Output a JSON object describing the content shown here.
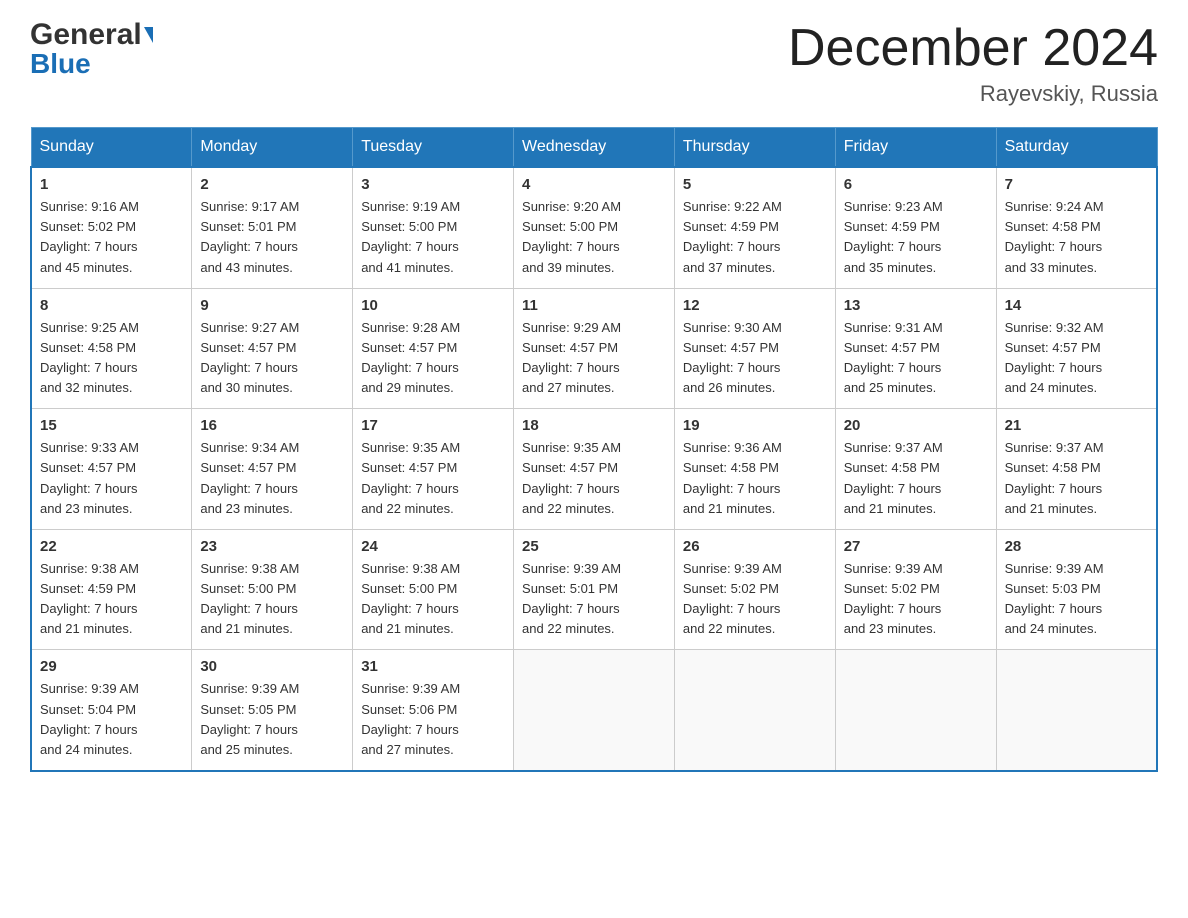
{
  "header": {
    "logo_general": "General",
    "logo_blue": "Blue",
    "month_title": "December 2024",
    "location": "Rayevskiy, Russia"
  },
  "weekdays": [
    "Sunday",
    "Monday",
    "Tuesday",
    "Wednesday",
    "Thursday",
    "Friday",
    "Saturday"
  ],
  "weeks": [
    [
      {
        "day": "1",
        "sunrise": "9:16 AM",
        "sunset": "5:02 PM",
        "daylight": "7 hours and 45 minutes."
      },
      {
        "day": "2",
        "sunrise": "9:17 AM",
        "sunset": "5:01 PM",
        "daylight": "7 hours and 43 minutes."
      },
      {
        "day": "3",
        "sunrise": "9:19 AM",
        "sunset": "5:00 PM",
        "daylight": "7 hours and 41 minutes."
      },
      {
        "day": "4",
        "sunrise": "9:20 AM",
        "sunset": "5:00 PM",
        "daylight": "7 hours and 39 minutes."
      },
      {
        "day": "5",
        "sunrise": "9:22 AM",
        "sunset": "4:59 PM",
        "daylight": "7 hours and 37 minutes."
      },
      {
        "day": "6",
        "sunrise": "9:23 AM",
        "sunset": "4:59 PM",
        "daylight": "7 hours and 35 minutes."
      },
      {
        "day": "7",
        "sunrise": "9:24 AM",
        "sunset": "4:58 PM",
        "daylight": "7 hours and 33 minutes."
      }
    ],
    [
      {
        "day": "8",
        "sunrise": "9:25 AM",
        "sunset": "4:58 PM",
        "daylight": "7 hours and 32 minutes."
      },
      {
        "day": "9",
        "sunrise": "9:27 AM",
        "sunset": "4:57 PM",
        "daylight": "7 hours and 30 minutes."
      },
      {
        "day": "10",
        "sunrise": "9:28 AM",
        "sunset": "4:57 PM",
        "daylight": "7 hours and 29 minutes."
      },
      {
        "day": "11",
        "sunrise": "9:29 AM",
        "sunset": "4:57 PM",
        "daylight": "7 hours and 27 minutes."
      },
      {
        "day": "12",
        "sunrise": "9:30 AM",
        "sunset": "4:57 PM",
        "daylight": "7 hours and 26 minutes."
      },
      {
        "day": "13",
        "sunrise": "9:31 AM",
        "sunset": "4:57 PM",
        "daylight": "7 hours and 25 minutes."
      },
      {
        "day": "14",
        "sunrise": "9:32 AM",
        "sunset": "4:57 PM",
        "daylight": "7 hours and 24 minutes."
      }
    ],
    [
      {
        "day": "15",
        "sunrise": "9:33 AM",
        "sunset": "4:57 PM",
        "daylight": "7 hours and 23 minutes."
      },
      {
        "day": "16",
        "sunrise": "9:34 AM",
        "sunset": "4:57 PM",
        "daylight": "7 hours and 23 minutes."
      },
      {
        "day": "17",
        "sunrise": "9:35 AM",
        "sunset": "4:57 PM",
        "daylight": "7 hours and 22 minutes."
      },
      {
        "day": "18",
        "sunrise": "9:35 AM",
        "sunset": "4:57 PM",
        "daylight": "7 hours and 22 minutes."
      },
      {
        "day": "19",
        "sunrise": "9:36 AM",
        "sunset": "4:58 PM",
        "daylight": "7 hours and 21 minutes."
      },
      {
        "day": "20",
        "sunrise": "9:37 AM",
        "sunset": "4:58 PM",
        "daylight": "7 hours and 21 minutes."
      },
      {
        "day": "21",
        "sunrise": "9:37 AM",
        "sunset": "4:58 PM",
        "daylight": "7 hours and 21 minutes."
      }
    ],
    [
      {
        "day": "22",
        "sunrise": "9:38 AM",
        "sunset": "4:59 PM",
        "daylight": "7 hours and 21 minutes."
      },
      {
        "day": "23",
        "sunrise": "9:38 AM",
        "sunset": "5:00 PM",
        "daylight": "7 hours and 21 minutes."
      },
      {
        "day": "24",
        "sunrise": "9:38 AM",
        "sunset": "5:00 PM",
        "daylight": "7 hours and 21 minutes."
      },
      {
        "day": "25",
        "sunrise": "9:39 AM",
        "sunset": "5:01 PM",
        "daylight": "7 hours and 22 minutes."
      },
      {
        "day": "26",
        "sunrise": "9:39 AM",
        "sunset": "5:02 PM",
        "daylight": "7 hours and 22 minutes."
      },
      {
        "day": "27",
        "sunrise": "9:39 AM",
        "sunset": "5:02 PM",
        "daylight": "7 hours and 23 minutes."
      },
      {
        "day": "28",
        "sunrise": "9:39 AM",
        "sunset": "5:03 PM",
        "daylight": "7 hours and 24 minutes."
      }
    ],
    [
      {
        "day": "29",
        "sunrise": "9:39 AM",
        "sunset": "5:04 PM",
        "daylight": "7 hours and 24 minutes."
      },
      {
        "day": "30",
        "sunrise": "9:39 AM",
        "sunset": "5:05 PM",
        "daylight": "7 hours and 25 minutes."
      },
      {
        "day": "31",
        "sunrise": "9:39 AM",
        "sunset": "5:06 PM",
        "daylight": "7 hours and 27 minutes."
      },
      null,
      null,
      null,
      null
    ]
  ],
  "labels": {
    "sunrise": "Sunrise:",
    "sunset": "Sunset:",
    "daylight": "Daylight:"
  }
}
